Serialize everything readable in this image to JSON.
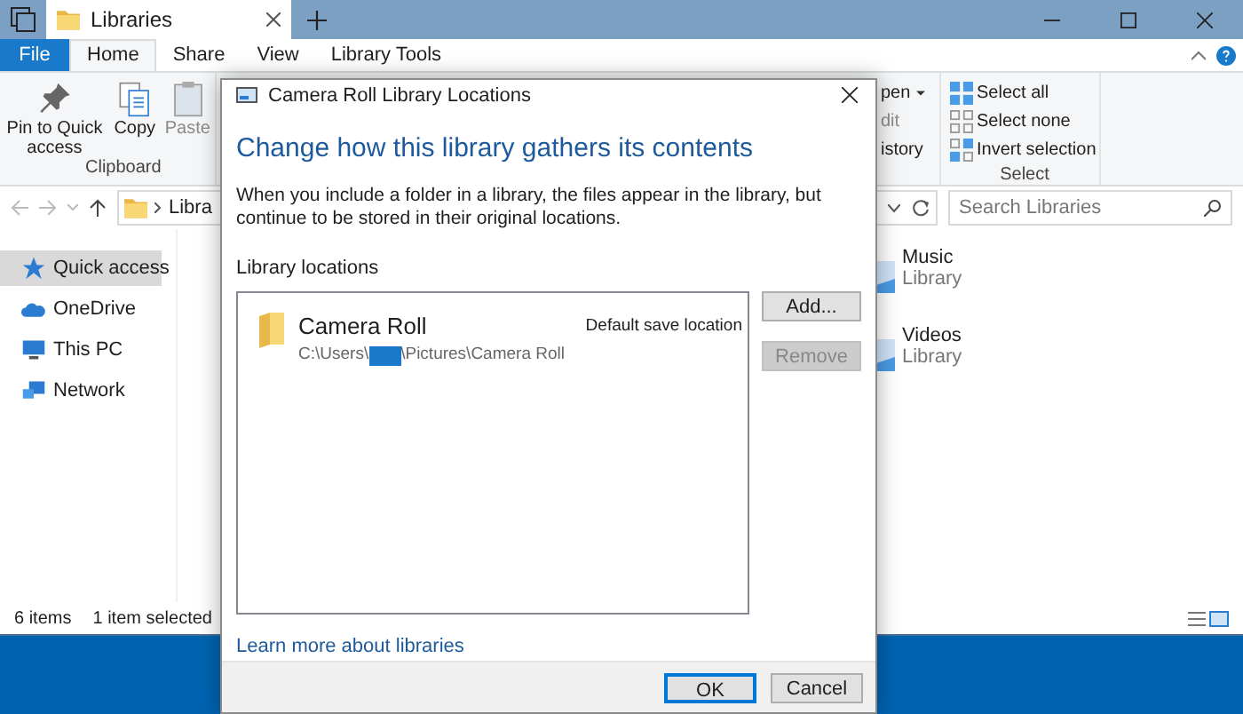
{
  "explorer": {
    "tab_title": "Libraries",
    "ribbon_tabs": [
      {
        "label": "File",
        "kind": "file",
        "selected": false
      },
      {
        "label": "Home",
        "kind": "tab",
        "selected": true
      },
      {
        "label": "Share",
        "kind": "tab",
        "selected": false
      },
      {
        "label": "View",
        "kind": "tab",
        "selected": false
      },
      {
        "label": "Library Tools",
        "kind": "tab",
        "selected": false
      }
    ],
    "clipboard": {
      "group": "Clipboard",
      "buttons": [
        {
          "label": "Pin to Quick access",
          "kind": "pin",
          "disabled": false
        },
        {
          "label": "Copy",
          "kind": "copy",
          "disabled": false
        },
        {
          "label": "Paste",
          "kind": "paste",
          "disabled": true
        }
      ]
    },
    "open_group": [
      {
        "label": "pen",
        "disabled": false,
        "dropdown": true
      },
      {
        "label": "dit",
        "disabled": true,
        "dropdown": false
      },
      {
        "label": "istory",
        "disabled": false,
        "dropdown": false
      }
    ],
    "select_group": {
      "group": "Select",
      "items": [
        {
          "label": "Select all",
          "kind": "all"
        },
        {
          "label": "Select none",
          "kind": "none"
        },
        {
          "label": "Invert selection",
          "kind": "invert"
        }
      ]
    },
    "address": "Libra",
    "search_placeholder": "Search Libraries",
    "nav": [
      {
        "label": "Quick access",
        "kind": "star",
        "selected": true
      },
      {
        "label": "OneDrive",
        "kind": "cloud",
        "selected": false
      },
      {
        "label": "This PC",
        "kind": "pc",
        "selected": false
      },
      {
        "label": "Network",
        "kind": "network",
        "selected": false
      }
    ],
    "libraries": [
      {
        "name": "Music",
        "type": "Library"
      },
      {
        "name": "Videos",
        "type": "Library"
      }
    ],
    "status": {
      "count": "6 items",
      "selection": "1 item selected"
    }
  },
  "dialog": {
    "title": "Camera Roll Library Locations",
    "heading": "Change how this library gathers its contents",
    "description": "When you include a folder in a library, the files appear in the library, but continue to be stored in their original locations.",
    "list_label": "Library locations",
    "locations": [
      {
        "name": "Camera Roll",
        "path_start": "C:\\Users\\",
        "path_end": "\\Pictures\\Camera Roll",
        "note": "Default save location"
      }
    ],
    "side_buttons": [
      {
        "label": "Add...",
        "disabled": false
      },
      {
        "label": "Remove",
        "disabled": true
      }
    ],
    "link": "Learn more about libraries",
    "footer_buttons": [
      {
        "label": "OK",
        "default": true
      },
      {
        "label": "Cancel",
        "default": false
      }
    ]
  }
}
